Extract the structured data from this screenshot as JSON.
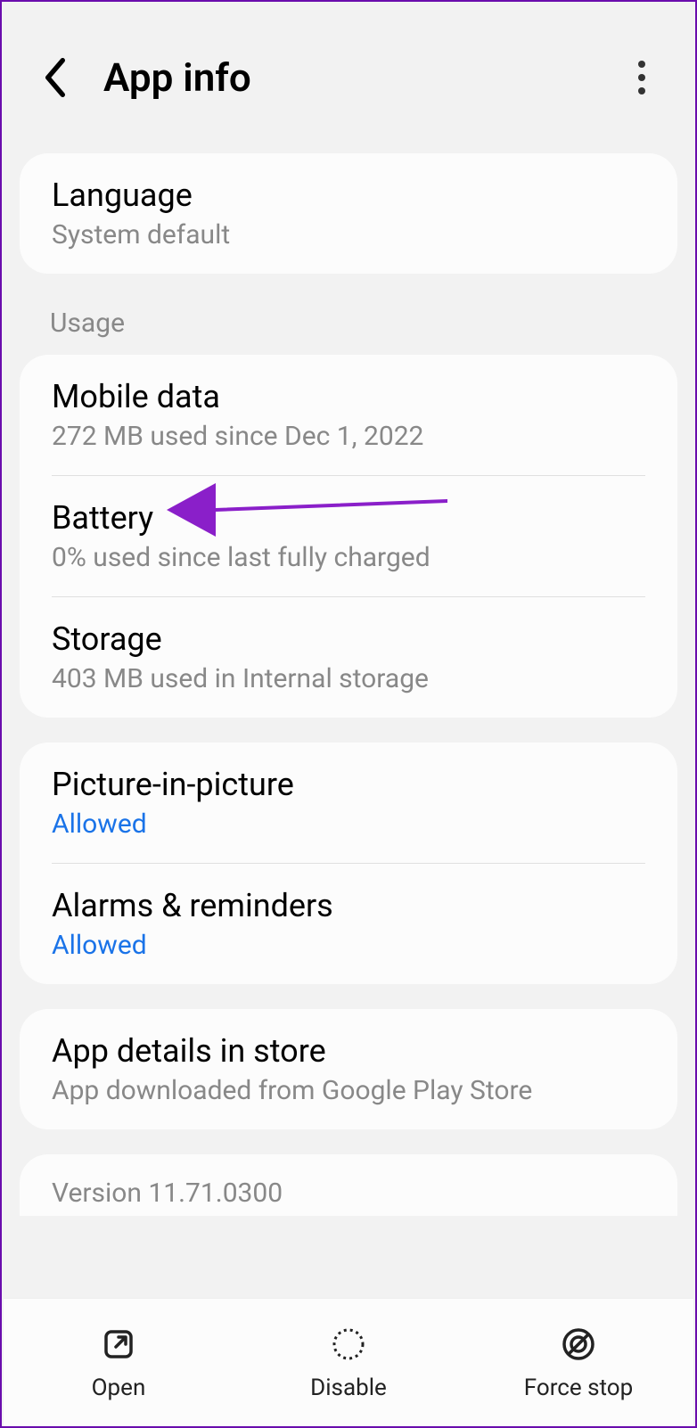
{
  "header": {
    "title": "App info"
  },
  "language": {
    "title": "Language",
    "value": "System default"
  },
  "section_usage": "Usage",
  "mobile_data": {
    "title": "Mobile data",
    "value": "272 MB used since Dec 1, 2022"
  },
  "battery": {
    "title": "Battery",
    "value": "0% used since last fully charged"
  },
  "storage": {
    "title": "Storage",
    "value": "403 MB used in Internal storage"
  },
  "pip": {
    "title": "Picture-in-picture",
    "status": "Allowed"
  },
  "alarms": {
    "title": "Alarms & reminders",
    "status": "Allowed"
  },
  "app_details": {
    "title": "App details in store",
    "value": "App downloaded from Google Play Store"
  },
  "version": "Version 11.71.0300",
  "bottom": {
    "open": "Open",
    "disable": "Disable",
    "force_stop": "Force stop"
  },
  "colors": {
    "arrow": "#8a1fc9"
  }
}
